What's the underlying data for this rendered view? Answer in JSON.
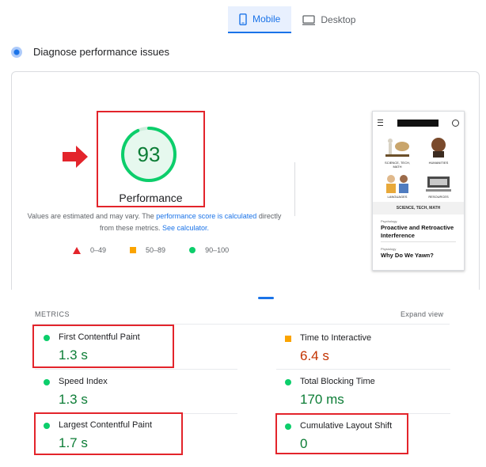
{
  "tabs": [
    {
      "label": "Mobile",
      "icon": "mobile-phone-icon",
      "active": true
    },
    {
      "label": "Desktop",
      "icon": "desktop-monitor-icon",
      "active": false
    }
  ],
  "section": {
    "title": "Diagnose performance issues"
  },
  "score": {
    "value": "93",
    "label": "Performance",
    "color": "#0cce6b"
  },
  "note": {
    "text1": "Values are estimated and may vary. The ",
    "link1": "performance score is calculated",
    "text2": " directly from these metrics. ",
    "link2": "See calculator."
  },
  "legend": [
    {
      "label": "0–49",
      "shape": "triangle",
      "color": "#e3242b"
    },
    {
      "label": "50–89",
      "shape": "square",
      "color": "#fba400"
    },
    {
      "label": "90–100",
      "shape": "circle",
      "color": "#0cce6b"
    }
  ],
  "thumbnail": {
    "tiles": [
      "SCIENCE, TECH, MATH",
      "HUMANITIES",
      "LANGUAGES",
      "RESOURCES"
    ],
    "band": "SCIENCE, TECH, MATH",
    "article1_kicker": "Psychology",
    "article1_title": "Proactive and Retroactive Interference",
    "article2_kicker": "Physiology",
    "article2_title": "Why Do We Yawn?"
  },
  "metrics_header": {
    "title": "METRICS",
    "expand": "Expand view"
  },
  "metrics": [
    {
      "name": "First Contentful Paint",
      "value": "1.3 s",
      "rating": "good"
    },
    {
      "name": "Time to Interactive",
      "value": "6.4 s",
      "rating": "average"
    },
    {
      "name": "Speed Index",
      "value": "1.3 s",
      "rating": "good"
    },
    {
      "name": "Total Blocking Time",
      "value": "170 ms",
      "rating": "good"
    },
    {
      "name": "Largest Contentful Paint",
      "value": "1.7 s",
      "rating": "good"
    },
    {
      "name": "Cumulative Layout Shift",
      "value": "0",
      "rating": "good"
    }
  ],
  "colors": {
    "accent": "#1a73e8",
    "highlight": "#e3242b",
    "good": "#0cce6b",
    "average": "#fba400"
  }
}
